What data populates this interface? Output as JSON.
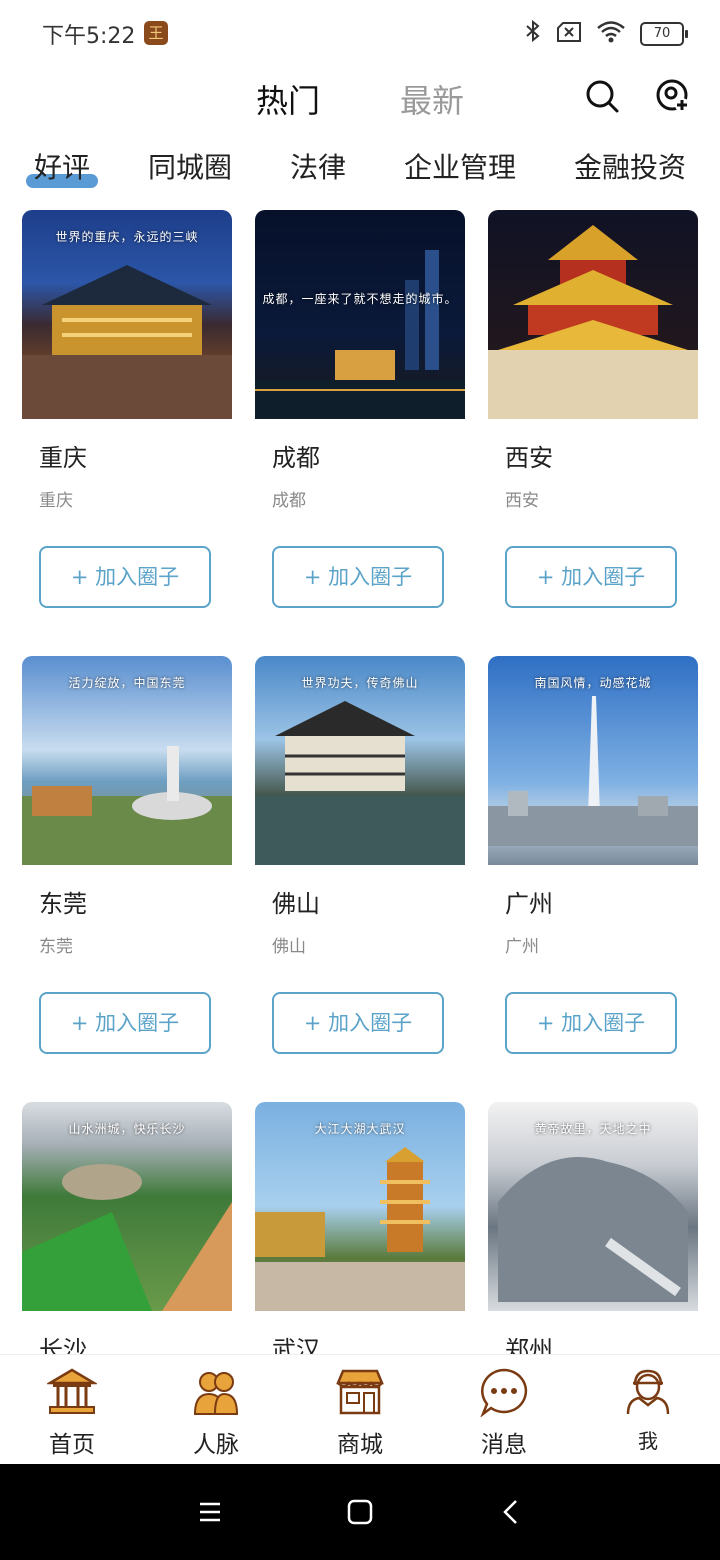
{
  "status": {
    "time": "下午5:22",
    "app_glyph": "王",
    "battery": "70"
  },
  "header": {
    "tab_hot": "热门",
    "tab_new": "最新"
  },
  "categories": [
    "好评",
    "同城圈",
    "法律",
    "企业管理",
    "金融投资"
  ],
  "join_label": "+ 加入圈子",
  "cards": [
    {
      "name": "重庆",
      "sub": "重庆",
      "caption": "世界的重庆，永远的三峡"
    },
    {
      "name": "成都",
      "sub": "成都",
      "caption": "成都，一座来了就不想走的城市。"
    },
    {
      "name": "西安",
      "sub": "西安",
      "caption": ""
    },
    {
      "name": "东莞",
      "sub": "东莞",
      "caption": "活力绽放，中国东莞"
    },
    {
      "name": "佛山",
      "sub": "佛山",
      "caption": "世界功夫，传奇佛山"
    },
    {
      "name": "广州",
      "sub": "广州",
      "caption": "南国风情，动感花城"
    },
    {
      "name": "长沙",
      "sub": "",
      "caption": "山水洲城，快乐长沙"
    },
    {
      "name": "武汉",
      "sub": "",
      "caption": "大江大湖大武汉"
    },
    {
      "name": "郑州",
      "sub": "",
      "caption": "黄帝故里，天地之中"
    }
  ],
  "nav": [
    "首页",
    "人脉",
    "商城",
    "消息",
    "我"
  ],
  "colors": {
    "accent": "#5ba3c9",
    "underline": "#5b9bd5",
    "nav_icon": "#7a3a12",
    "nav_icon_fill": "#e8a33a"
  }
}
